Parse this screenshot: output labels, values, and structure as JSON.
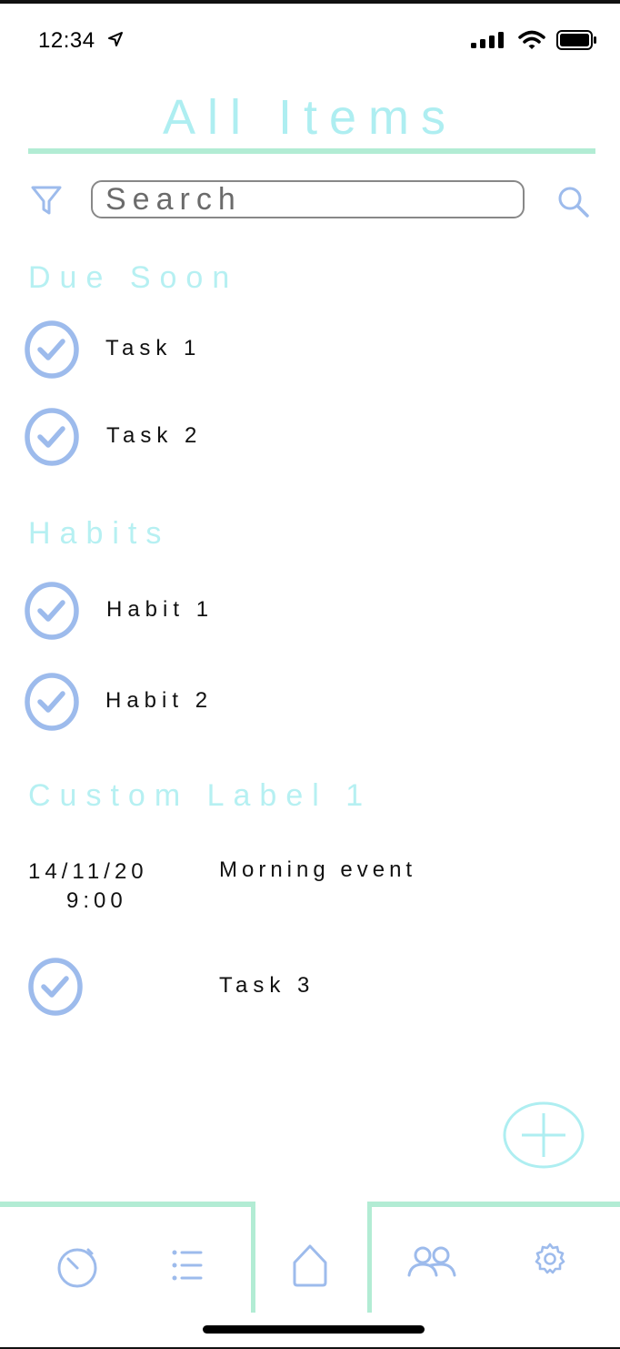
{
  "status_bar": {
    "time": "12:34"
  },
  "header": {
    "title": "All Items"
  },
  "search": {
    "placeholder": "Search"
  },
  "sections": {
    "due_soon": {
      "title": "Due Soon",
      "items": [
        {
          "label": "Task 1"
        },
        {
          "label": "Task 2"
        }
      ]
    },
    "habits": {
      "title": "Habits",
      "items": [
        {
          "label": "Habit 1"
        },
        {
          "label": "Habit 2"
        }
      ]
    },
    "custom": {
      "title": "Custom Label 1",
      "event": {
        "date": "14/11/20",
        "time": "9:00",
        "title": "Morning event"
      },
      "task": {
        "label": "Task 3"
      }
    }
  },
  "icons": {
    "filter": "filter-icon",
    "search": "search-icon",
    "check": "check-circle-icon",
    "add": "plus-icon",
    "timer": "timer-icon",
    "list": "list-icon",
    "home": "home-icon",
    "people": "people-icon",
    "settings": "gear-icon"
  },
  "colors": {
    "accent_blue": "#9dbbec",
    "title_cyan": "#aeeef1",
    "section_cyan": "#b6f0f2",
    "rule_green": "#b2ecd4"
  }
}
